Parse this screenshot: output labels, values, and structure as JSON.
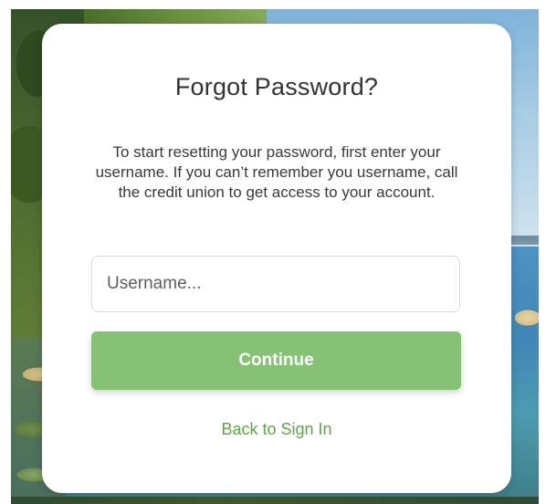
{
  "forgot_password": {
    "title": "Forgot Password?",
    "description": "To start resetting your password, first enter your username. If you can’t remember you username, call the credit union to get access to your account.",
    "username": {
      "value": "",
      "placeholder": "Username..."
    },
    "continue_label": "Continue",
    "back_link_label": "Back to Sign In"
  },
  "colors": {
    "button": "#86c273",
    "link": "#5aaa3e",
    "title": "#333333"
  }
}
